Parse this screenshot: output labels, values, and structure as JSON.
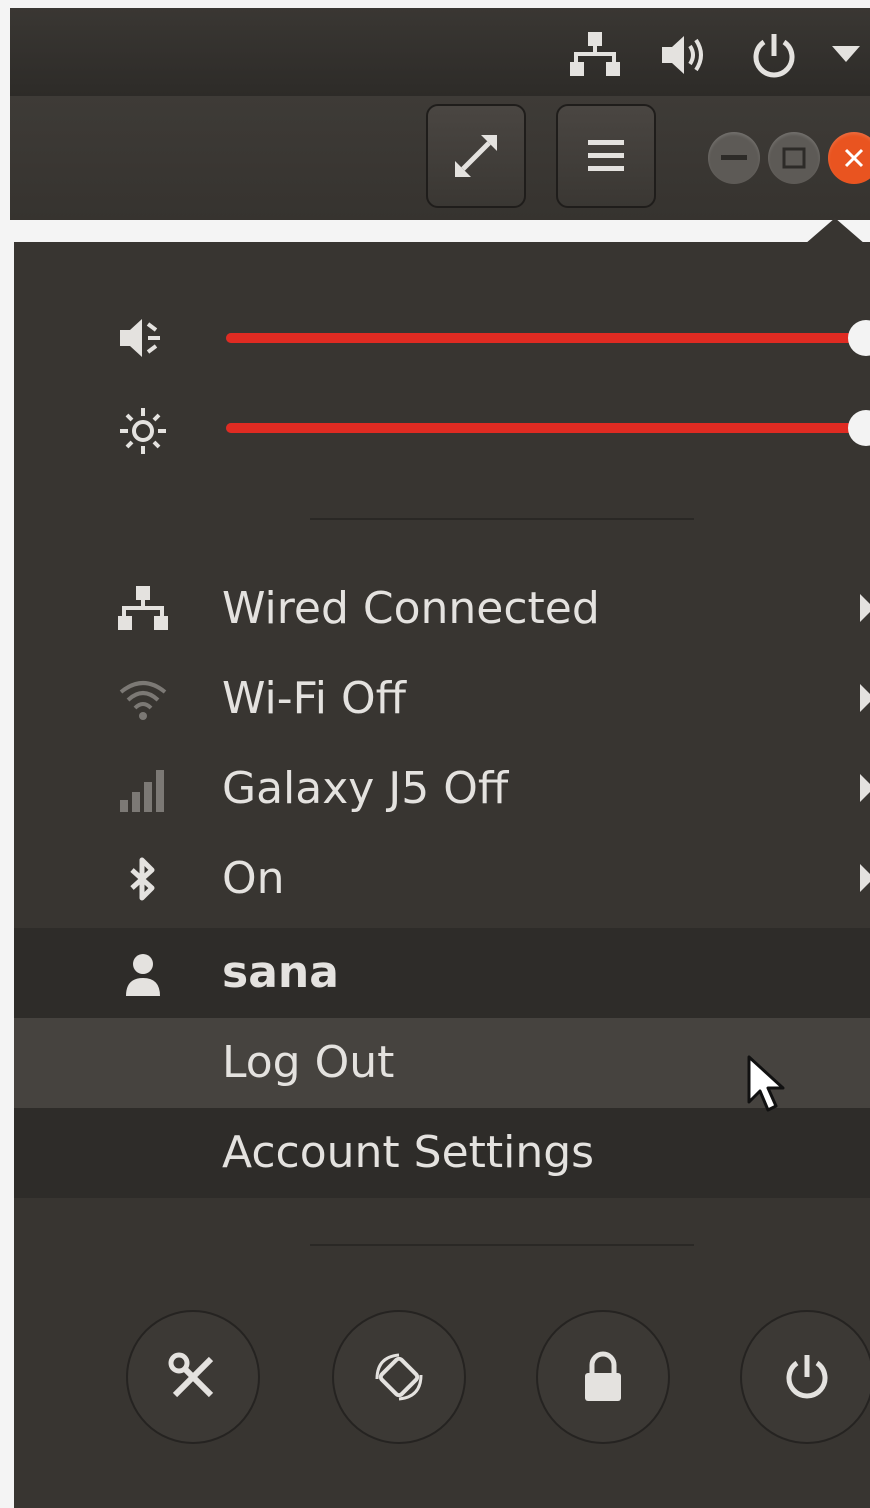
{
  "top_bar": {
    "icons": [
      "network-wired-icon",
      "volume-icon",
      "power-icon",
      "chevron-down-icon"
    ]
  },
  "header_bar": {
    "buttons": [
      "fullscreen-icon",
      "hamburger-menu-icon"
    ],
    "window_controls": [
      "minimize-icon",
      "maximize-icon",
      "close-icon"
    ]
  },
  "system_menu": {
    "volume_slider": {
      "icon": "volume-muted-icon",
      "value": 1.0
    },
    "brightness_slider": {
      "icon": "brightness-icon",
      "value": 1.0
    },
    "items": [
      {
        "icon": "wired-network-icon",
        "label": "Wired Connected"
      },
      {
        "icon": "wifi-icon",
        "label": "Wi-Fi Off"
      },
      {
        "icon": "cellular-signal-icon",
        "label": "Galaxy J5 Off"
      },
      {
        "icon": "bluetooth-icon",
        "label": "On"
      }
    ],
    "user": {
      "icon": "user-icon",
      "name": "sana",
      "submenu": [
        "Log Out",
        "Account Settings"
      ]
    },
    "action_buttons": [
      "settings-icon",
      "rotation-lock-icon",
      "lock-icon",
      "power-off-icon"
    ]
  },
  "colors": {
    "accent": "#e02b22",
    "menu_bg": "#383531",
    "text": "#e4e2df",
    "close_button": "#e95420"
  }
}
